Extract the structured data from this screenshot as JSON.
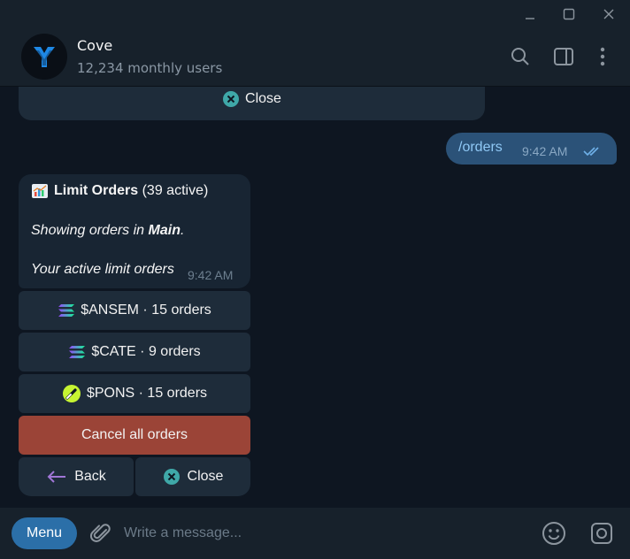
{
  "chat": {
    "title": "Cove",
    "subtitle": "12,234 monthly users"
  },
  "top_button": {
    "label": "Close"
  },
  "outgoing": {
    "text": "/orders",
    "time": "9:42 AM"
  },
  "incoming": {
    "title": "Limit Orders",
    "active": "(39 active)",
    "showing_prefix": "Showing orders in ",
    "showing_wallet": "Main",
    "showing_suffix": ".",
    "line3": "Your active limit orders",
    "time": "9:42 AM"
  },
  "inline_buttons": {
    "ansem": "$ANSEM · 15 orders",
    "cate": "$CATE · 9 orders",
    "pons": "$PONS · 15 orders",
    "cancel": "Cancel all orders",
    "back": "Back",
    "close": "Close"
  },
  "composer": {
    "menu_label": "Menu",
    "placeholder": "Write a message..."
  },
  "colors": {
    "accent": "#2b6fa8",
    "cancel": "#9b4437",
    "outgoing_bubble": "#2b5278"
  }
}
